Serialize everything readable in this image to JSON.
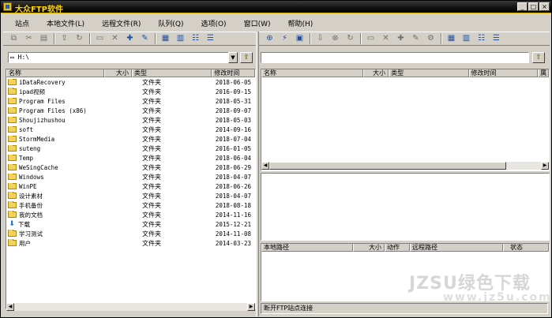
{
  "window": {
    "title": "大众FTP软件",
    "brand_color": "#ffd400"
  },
  "menu": [
    "站点",
    "本地文件(L)",
    "远程文件(R)",
    "队列(Q)",
    "选项(O)",
    "窗口(W)",
    "帮助(H)"
  ],
  "local": {
    "path": "H:\\",
    "columns": [
      "名称",
      "大小",
      "类型",
      "修改时间"
    ],
    "rows": [
      {
        "name": "iDataRecovery",
        "type": "文件夹",
        "date": "2018-06-05",
        "icon": "folder-icon"
      },
      {
        "name": "ipad视频",
        "type": "文件夹",
        "date": "2016-09-15",
        "icon": "folder-icon"
      },
      {
        "name": "Program Files",
        "type": "文件夹",
        "date": "2018-05-31",
        "icon": "folder-icon"
      },
      {
        "name": "Program Files (x86)",
        "type": "文件夹",
        "date": "2018-09-07",
        "icon": "folder-icon"
      },
      {
        "name": "Shoujizhushou",
        "type": "文件夹",
        "date": "2018-05-03",
        "icon": "folder-icon"
      },
      {
        "name": "soft",
        "type": "文件夹",
        "date": "2014-09-16",
        "icon": "folder-icon"
      },
      {
        "name": "StormMedia",
        "type": "文件夹",
        "date": "2018-07-04",
        "icon": "folder-icon"
      },
      {
        "name": "suteng",
        "type": "文件夹",
        "date": "2016-01-05",
        "icon": "folder-icon"
      },
      {
        "name": "Temp",
        "type": "文件夹",
        "date": "2018-06-04",
        "icon": "folder-icon"
      },
      {
        "name": "WeSingCache",
        "type": "文件夹",
        "date": "2018-06-29",
        "icon": "folder-icon"
      },
      {
        "name": "Windows",
        "type": "文件夹",
        "date": "2018-04-07",
        "icon": "folder-icon"
      },
      {
        "name": "WinPE",
        "type": "文件夹",
        "date": "2018-06-26",
        "icon": "folder-icon"
      },
      {
        "name": "设计素材",
        "type": "文件夹",
        "date": "2018-04-07",
        "icon": "folder-icon"
      },
      {
        "name": "手机备份",
        "type": "文件夹",
        "date": "2018-08-18",
        "icon": "folder-icon"
      },
      {
        "name": "我的文档",
        "type": "文件夹",
        "date": "2014-11-16",
        "icon": "folder-icon"
      },
      {
        "name": "下载",
        "type": "文件夹",
        "date": "2015-12-21",
        "icon": "download-folder-icon"
      },
      {
        "name": "学习测试",
        "type": "文件夹",
        "date": "2014-11-08",
        "icon": "folder-icon"
      },
      {
        "name": "用户",
        "type": "文件夹",
        "date": "2014-03-23",
        "icon": "folder-icon"
      }
    ]
  },
  "remote": {
    "path": "",
    "columns": [
      "名称",
      "大小",
      "类型",
      "修改时间",
      "属"
    ]
  },
  "queue": {
    "columns": [
      "本地路径",
      "大小",
      "动作",
      "远程路径",
      "状态"
    ]
  },
  "status": "断开FTP站点连接",
  "watermark": {
    "line1": "JZSU绿色下载",
    "line2": "www.jz5u.com"
  }
}
